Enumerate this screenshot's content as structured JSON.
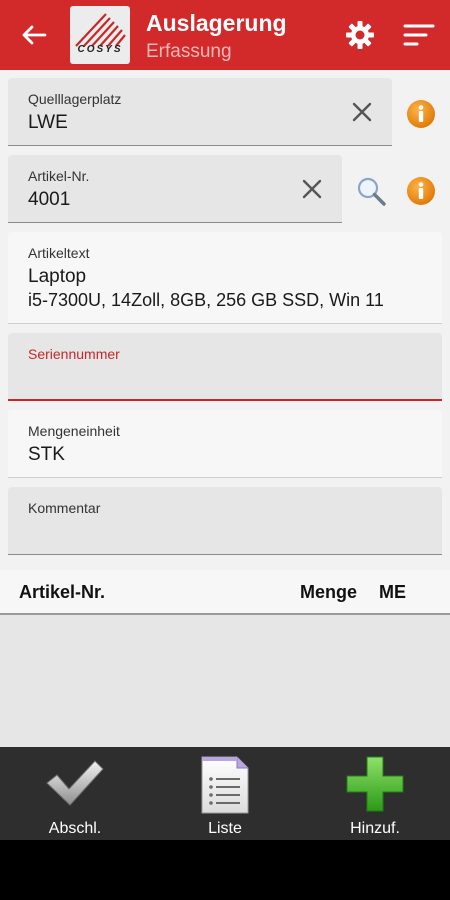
{
  "header": {
    "title": "Auslagerung",
    "subtitle": "Erfassung",
    "logo_text": "COSYS",
    "back_icon": "arrow-left-icon",
    "settings_icon": "gear-icon",
    "menu_icon": "sort-icon"
  },
  "fields": {
    "quelllagerplatz": {
      "label": "Quelllagerplatz",
      "value": "LWE"
    },
    "artikel_nr": {
      "label": "Artikel-Nr.",
      "value": "4001"
    },
    "artikeltext": {
      "label": "Artikeltext",
      "line1": "Laptop",
      "line2": "i5-7300U, 14Zoll, 8GB, 256 GB SSD, Win 11"
    },
    "seriennummer": {
      "label": "Seriennummer",
      "value": ""
    },
    "mengeneinheit": {
      "label": "Mengeneinheit",
      "value": "STK"
    },
    "kommentar": {
      "label": "Kommentar",
      "value": ""
    }
  },
  "table": {
    "columns": [
      "Artikel-Nr.",
      "Menge",
      "ME"
    ],
    "rows": []
  },
  "toolbar": {
    "finish_label": "Abschl.",
    "list_label": "Liste",
    "add_label": "Hinzuf."
  },
  "colors": {
    "header": "#d22a2a",
    "accent": "#c62828",
    "info": "#f28c1a",
    "toolbar": "#2e2e2e",
    "add_green": "#3cb521"
  }
}
